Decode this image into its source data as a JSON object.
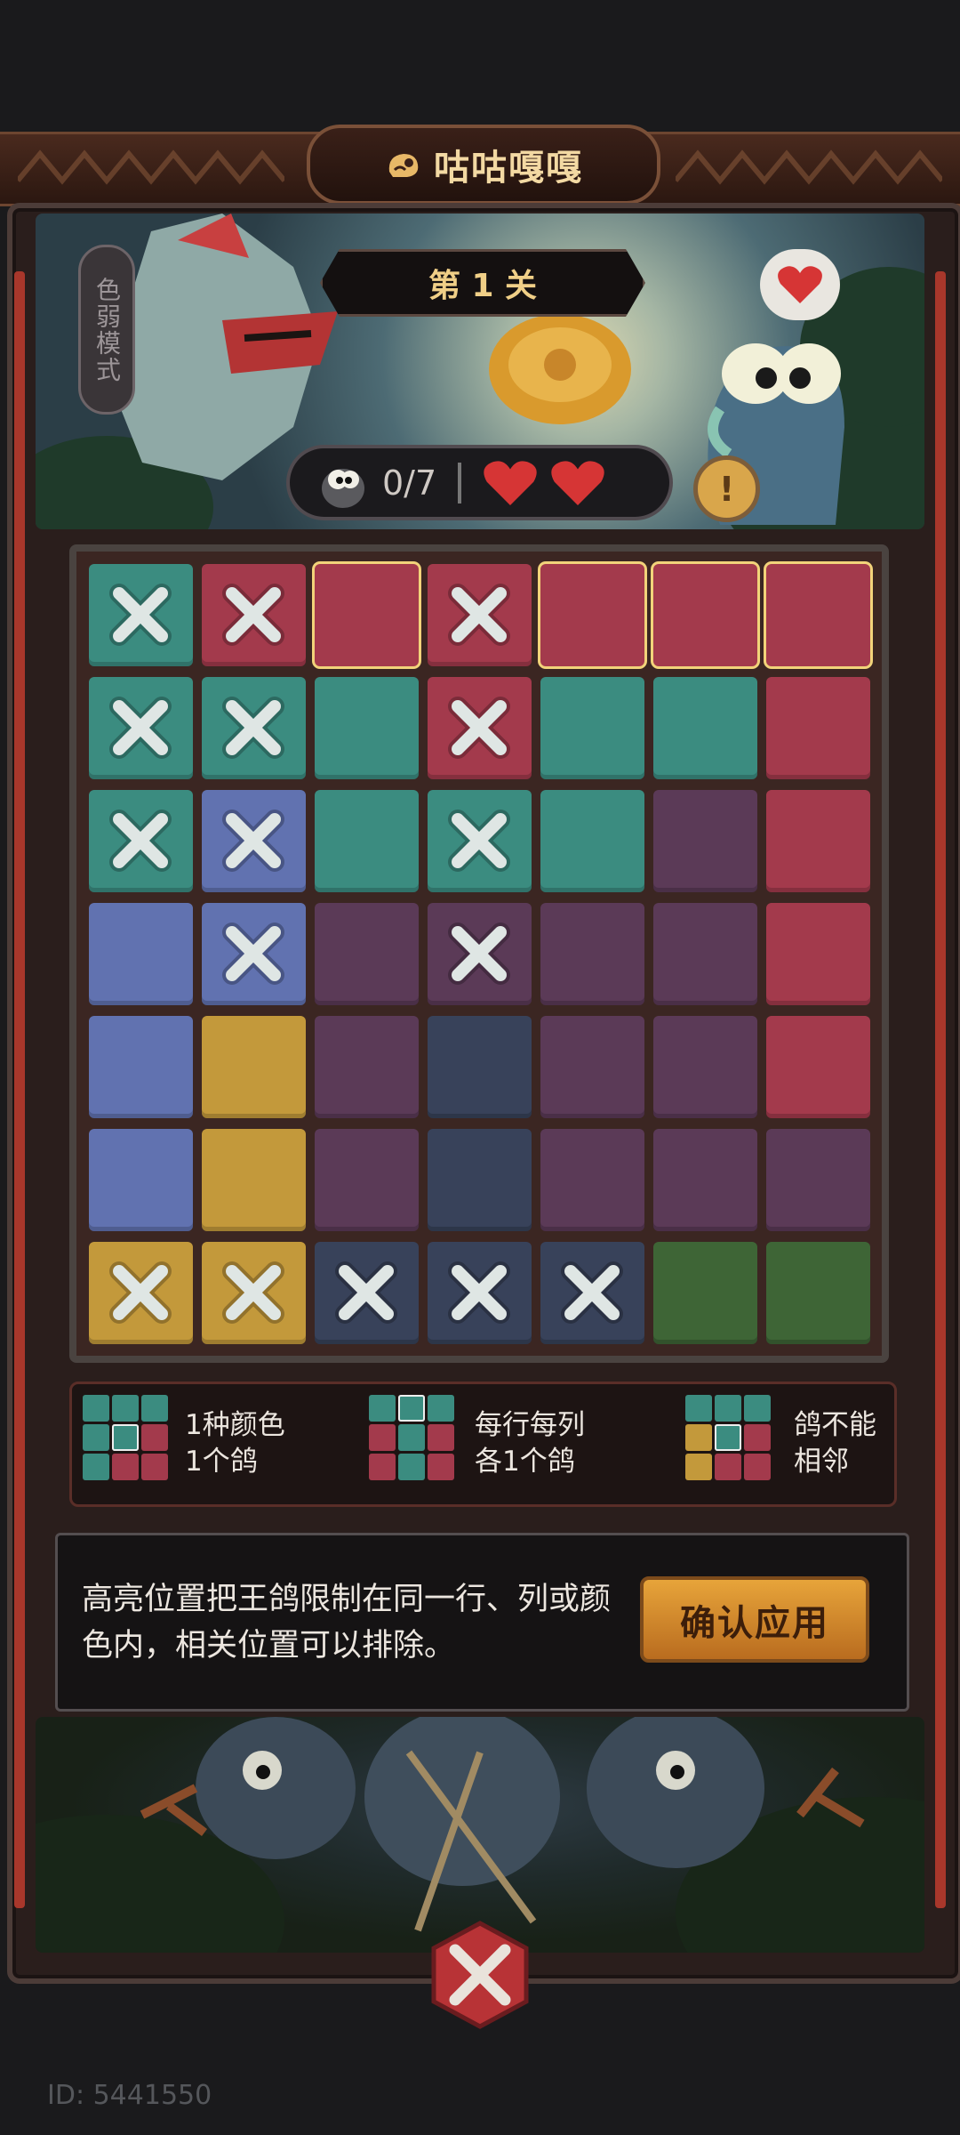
{
  "game_title": "咕咕嘎嘎",
  "level_label": "第 1 关",
  "colorblind_mode": "色弱模式",
  "progress": {
    "found": 0,
    "total": 7,
    "display": "0/7"
  },
  "lives": 2,
  "hint_icon": "!",
  "colors": {
    "T": "#3b8c80",
    "R": "#a33a4c",
    "B": "#6172b0",
    "P": "#5b3a57",
    "N": "#38425a",
    "Y": "#c3993b",
    "G": "#3e6536",
    "highlight": "#f2d37a"
  },
  "board": {
    "rows": [
      [
        "T",
        "R",
        "R",
        "R",
        "R",
        "R",
        "R"
      ],
      [
        "T",
        "T",
        "T",
        "R",
        "T",
        "T",
        "R"
      ],
      [
        "T",
        "B",
        "T",
        "T",
        "T",
        "P",
        "R"
      ],
      [
        "B",
        "B",
        "P",
        "P",
        "P",
        "P",
        "R"
      ],
      [
        "B",
        "Y",
        "P",
        "N",
        "P",
        "P",
        "R"
      ],
      [
        "B",
        "Y",
        "P",
        "N",
        "P",
        "P",
        "P"
      ],
      [
        "Y",
        "Y",
        "N",
        "N",
        "N",
        "G",
        "G"
      ]
    ],
    "marked": [
      [
        0,
        0
      ],
      [
        0,
        1
      ],
      [
        0,
        3
      ],
      [
        1,
        0
      ],
      [
        1,
        1
      ],
      [
        1,
        3
      ],
      [
        2,
        0
      ],
      [
        2,
        1
      ],
      [
        2,
        3
      ],
      [
        3,
        1
      ],
      [
        3,
        3
      ],
      [
        6,
        0
      ],
      [
        6,
        1
      ],
      [
        6,
        2
      ],
      [
        6,
        3
      ],
      [
        6,
        4
      ]
    ],
    "highlighted": [
      [
        0,
        2
      ],
      [
        0,
        4
      ],
      [
        0,
        5
      ],
      [
        0,
        6
      ]
    ]
  },
  "rules": [
    {
      "text": "1种颜色\n1个鸽"
    },
    {
      "text": "每行每列\n各1个鸽"
    },
    {
      "text": "鸽不能\n相邻"
    }
  ],
  "message": "高亮位置把王鸽限制在同一行、列或颜色内，相关位置可以排除。",
  "confirm_label": "确认应用",
  "id_label": "ID: 5441550"
}
